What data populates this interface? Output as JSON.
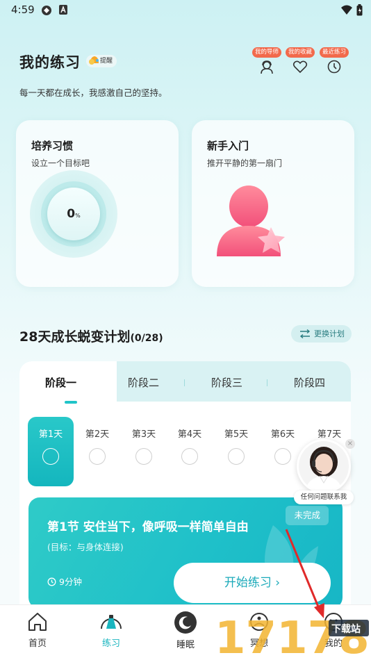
{
  "status_bar": {
    "time": "4:59"
  },
  "header": {
    "title": "我的练习",
    "remind_label": "提醒",
    "subtitle": "每一天都在成长，我感激自己的坚持。",
    "buttons": [
      {
        "tag": "我的导师",
        "icon": "mentor-icon"
      },
      {
        "tag": "我的收藏",
        "icon": "heart-icon"
      },
      {
        "tag": "最近练习",
        "icon": "clock-icon"
      }
    ]
  },
  "cards": {
    "habit": {
      "title": "培养习惯",
      "subtitle": "设立一个目标吧",
      "progress": "0",
      "progress_unit": "%"
    },
    "beginner": {
      "title": "新手入门",
      "subtitle": "推开平静的第一扇门"
    }
  },
  "plan": {
    "title": "28天成长蜕变计划",
    "count": "(0/28)",
    "change_label": "更换计划",
    "tabs": [
      "阶段一",
      "阶段二",
      "阶段三",
      "阶段四"
    ],
    "active_tab": 0,
    "days": [
      "第1天",
      "第2天",
      "第3天",
      "第4天",
      "第5天",
      "第6天",
      "第7天"
    ],
    "active_day": 0,
    "lesson": {
      "title": "第1节 安住当下，像呼吸一样简单自由",
      "goal": "(目标：与身体连接)",
      "duration": "9分钟",
      "status": "未完成",
      "start_label": "开始练习"
    }
  },
  "support": {
    "label": "任何问题联系我"
  },
  "nav": {
    "items": [
      {
        "label": "首页",
        "icon": "home-icon"
      },
      {
        "label": "练习",
        "icon": "practice-icon"
      },
      {
        "label": "睡眠",
        "icon": "moon-icon"
      },
      {
        "label": "冥想",
        "icon": "meditation-icon"
      },
      {
        "label": "我的",
        "icon": "profile-icon"
      }
    ],
    "active": 1
  },
  "watermark": {
    "text": "17178",
    "sub": "下载站"
  },
  "colors": {
    "accent": "#1ab5bf",
    "tag": "#f26a4c"
  }
}
